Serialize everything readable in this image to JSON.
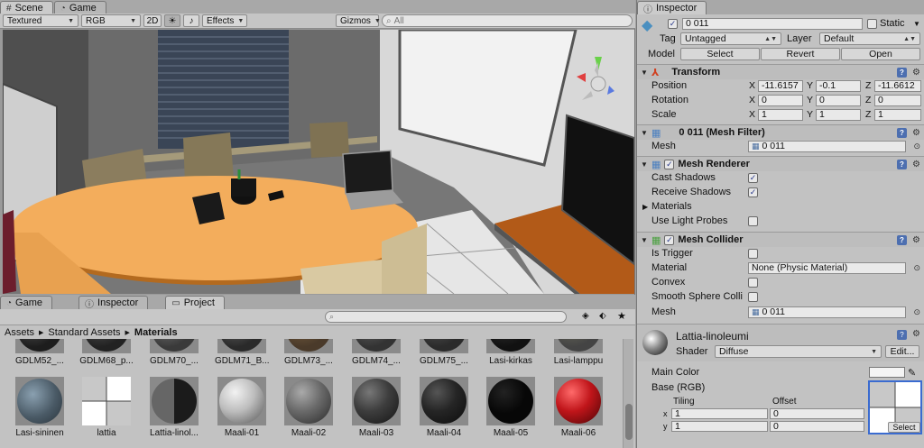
{
  "scene_tabs": [
    {
      "label": "Scene",
      "icon": "hash-icon"
    },
    {
      "label": "Game",
      "icon": "pacman-icon"
    }
  ],
  "scene_toolbar": {
    "shading": "Textured",
    "render_mode": "RGB",
    "mode_2d": "2D",
    "effects": "Effects",
    "gizmos": "Gizmos",
    "search_placeholder": "All"
  },
  "bottom_tabs": [
    {
      "label": "Game",
      "icon": "pacman-icon"
    },
    {
      "label": "Inspector",
      "icon": "info-icon"
    },
    {
      "label": "Project",
      "icon": "folder-icon"
    }
  ],
  "breadcrumb": [
    "Assets",
    "Standard Assets",
    "Materials"
  ],
  "assets_row1": [
    {
      "label": "GDLM52_...",
      "color": "#1d1d1d"
    },
    {
      "label": "GDLM68_p...",
      "color": "#222"
    },
    {
      "label": "GDLM70_...",
      "color": "#3a3a3a"
    },
    {
      "label": "GDLM71_B...",
      "color": "#2a2a2a"
    },
    {
      "label": "GDLM73_...",
      "color": "#4a3a2a"
    },
    {
      "label": "GDLM74_...",
      "color": "#333"
    },
    {
      "label": "GDLM75_...",
      "color": "#2b2b2b"
    },
    {
      "label": "Lasi-kirkas",
      "color": "#111"
    },
    {
      "label": "Lasi-lamppu",
      "color": "#444"
    }
  ],
  "assets_row2": [
    {
      "label": "Lasi-sininen",
      "color": "#4a5a66"
    },
    {
      "label": "lattia",
      "color": "#ffffff"
    },
    {
      "label": "Lattia-linol...",
      "color": "#333"
    },
    {
      "label": "Maali-01",
      "color": "#bdbdbd"
    },
    {
      "label": "Maali-02",
      "color": "#6a6a6a"
    },
    {
      "label": "Maali-03",
      "color": "#3d3d3d"
    },
    {
      "label": "Maali-04",
      "color": "#252525"
    },
    {
      "label": "Maali-05",
      "color": "#070707"
    },
    {
      "label": "Maali-06",
      "color": "#c0151a"
    }
  ],
  "inspector": {
    "tab": "Inspector",
    "object_name": "0      011",
    "static_label": "Static",
    "tag_label": "Tag",
    "tag_value": "Untagged",
    "layer_label": "Layer",
    "layer_value": "Default",
    "model_label": "Model",
    "model_select": "Select",
    "model_revert": "Revert",
    "model_open": "Open",
    "transform": {
      "title": "Transform",
      "position_label": "Position",
      "rotation_label": "Rotation",
      "scale_label": "Scale",
      "position": [
        "-11.6157",
        "-0.1",
        "-11.6612"
      ],
      "rotation": [
        "0",
        "0",
        "0"
      ],
      "scale": [
        "1",
        "1",
        "1"
      ],
      "axis": [
        "X",
        "Y",
        "Z"
      ]
    },
    "mesh_filter": {
      "title": "0      011 (Mesh Filter)",
      "mesh_label": "Mesh",
      "mesh_value": "0      011"
    },
    "mesh_renderer": {
      "title": "Mesh Renderer",
      "cast_shadows": "Cast Shadows",
      "receive_shadows": "Receive Shadows",
      "materials": "Materials",
      "use_light_probes": "Use Light Probes"
    },
    "mesh_collider": {
      "title": "Mesh Collider",
      "is_trigger": "Is Trigger",
      "material_label": "Material",
      "material_value": "None (Physic Material)",
      "convex": "Convex",
      "smooth": "Smooth Sphere Colli",
      "mesh_label": "Mesh",
      "mesh_value": "0      011"
    },
    "material": {
      "name": "Lattia-linoleumi",
      "shader_label": "Shader",
      "shader_value": "Diffuse",
      "edit": "Edit...",
      "main_color": "Main Color",
      "base_rgb": "Base (RGB)",
      "tiling": "Tiling",
      "offset": "Offset",
      "x_label": "x",
      "y_label": "y",
      "tiling_x": "1",
      "tiling_y": "1",
      "offset_x": "0",
      "offset_y": "0",
      "select": "Select"
    }
  }
}
